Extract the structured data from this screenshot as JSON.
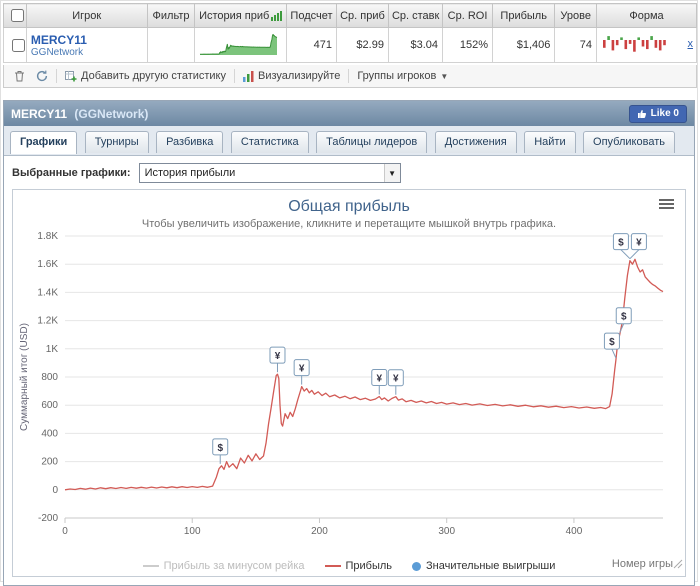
{
  "table": {
    "headers": [
      "Игрок",
      "Фильтр",
      "История приб",
      "Подсчет",
      "Ср. приб",
      "Ср. ставк",
      "Ср. ROI",
      "Прибыль",
      "Урове",
      "Форма"
    ],
    "row": {
      "player": "MERCY11",
      "network": "GGNetwork",
      "count": "471",
      "avg_profit": "$2.99",
      "avg_stake": "$3.04",
      "avg_roi": "152%",
      "profit": "$1,406",
      "level": "74",
      "remove_label": "x"
    },
    "form": [
      -6,
      3,
      -8,
      -4,
      2,
      -7,
      -3,
      -9,
      2,
      -5,
      -7,
      3,
      -6,
      -8,
      -4
    ]
  },
  "toolbar": {
    "add_stat": "Добавить другую статистику",
    "visualize": "Визуализируйте",
    "groups": "Группы игроков"
  },
  "panel": {
    "title_player": "MERCY11",
    "title_network": "(GGNetwork)",
    "like_label": "Like 0",
    "tabs": [
      "Графики",
      "Турниры",
      "Разбивка",
      "Статистика",
      "Таблицы лидеров",
      "Достижения",
      "Найти",
      "Опубликовать"
    ],
    "active_tab": "Графики",
    "selector_label": "Выбранные графики:",
    "selector_value": "История прибыли"
  },
  "chart_data": {
    "type": "line",
    "title": "Общая прибыль",
    "subtitle": "Чтобы увеличить изображение, кликните и перетащите мышкой внутрь графика.",
    "xlabel": "Номер игры",
    "ylabel": "Суммарный итог (USD)",
    "xlim": [
      0,
      470
    ],
    "ylim": [
      -200,
      1800
    ],
    "x_ticks": [
      0,
      100,
      200,
      300,
      400
    ],
    "y_ticks": [
      -200,
      0,
      200,
      400,
      600,
      800,
      1000,
      1200,
      1400,
      1600,
      1800
    ],
    "y_tick_labels": [
      "-200",
      "0",
      "200",
      "400",
      "600",
      "800",
      "1K",
      "1.2K",
      "1.4K",
      "1.6K",
      "1.8K"
    ],
    "grid": "horizontal",
    "legend_position": "bottom",
    "legend": [
      {
        "label": "Прибыль за минусом рейка",
        "color": "#cccccc",
        "type": "line",
        "disabled": true
      },
      {
        "label": "Прибыль",
        "color": "#d25b56",
        "type": "line",
        "disabled": false
      },
      {
        "label": "Значительные выигрыши",
        "color": "#5b9cd6",
        "type": "dot",
        "disabled": false
      }
    ],
    "series": [
      {
        "name": "Прибыль",
        "color": "#d25b56",
        "points": [
          [
            0,
            0
          ],
          [
            4,
            6
          ],
          [
            8,
            2
          ],
          [
            12,
            10
          ],
          [
            16,
            4
          ],
          [
            20,
            12
          ],
          [
            24,
            6
          ],
          [
            28,
            14
          ],
          [
            32,
            8
          ],
          [
            36,
            15
          ],
          [
            40,
            9
          ],
          [
            44,
            16
          ],
          [
            48,
            10
          ],
          [
            52,
            17
          ],
          [
            56,
            11
          ],
          [
            60,
            18
          ],
          [
            64,
            12
          ],
          [
            68,
            19
          ],
          [
            72,
            13
          ],
          [
            76,
            20
          ],
          [
            80,
            14
          ],
          [
            84,
            21
          ],
          [
            88,
            15
          ],
          [
            92,
            22
          ],
          [
            96,
            16
          ],
          [
            100,
            23
          ],
          [
            104,
            17
          ],
          [
            108,
            24
          ],
          [
            112,
            18
          ],
          [
            116,
            26
          ],
          [
            119,
            90
          ],
          [
            121,
            150
          ],
          [
            123,
            170
          ],
          [
            125,
            145
          ],
          [
            127,
            200
          ],
          [
            129,
            160
          ],
          [
            132,
            185
          ],
          [
            135,
            150
          ],
          [
            138,
            225
          ],
          [
            141,
            190
          ],
          [
            144,
            245
          ],
          [
            147,
            205
          ],
          [
            150,
            255
          ],
          [
            153,
            215
          ],
          [
            156,
            240
          ],
          [
            158,
            330
          ],
          [
            160,
            470
          ],
          [
            162,
            580
          ],
          [
            164,
            700
          ],
          [
            166,
            810
          ],
          [
            167,
            820
          ],
          [
            168,
            790
          ],
          [
            169,
            600
          ],
          [
            170,
            470
          ],
          [
            171,
            452
          ],
          [
            173,
            540
          ],
          [
            175,
            505
          ],
          [
            177,
            550
          ],
          [
            179,
            520
          ],
          [
            181,
            575
          ],
          [
            183,
            640
          ],
          [
            185,
            700
          ],
          [
            186,
            732
          ],
          [
            188,
            700
          ],
          [
            190,
            718
          ],
          [
            192,
            688
          ],
          [
            194,
            705
          ],
          [
            196,
            678
          ],
          [
            199,
            695
          ],
          [
            202,
            668
          ],
          [
            205,
            685
          ],
          [
            208,
            660
          ],
          [
            212,
            672
          ],
          [
            216,
            652
          ],
          [
            220,
            664
          ],
          [
            224,
            646
          ],
          [
            228,
            658
          ],
          [
            232,
            640
          ],
          [
            236,
            650
          ],
          [
            240,
            634
          ],
          [
            244,
            644
          ],
          [
            247,
            662
          ],
          [
            249,
            640
          ],
          [
            251,
            652
          ],
          [
            254,
            630
          ],
          [
            257,
            648
          ],
          [
            260,
            660
          ],
          [
            262,
            636
          ],
          [
            265,
            645
          ],
          [
            268,
            625
          ],
          [
            272,
            634
          ],
          [
            276,
            620
          ],
          [
            280,
            630
          ],
          [
            284,
            616
          ],
          [
            288,
            626
          ],
          [
            292,
            612
          ],
          [
            296,
            620
          ],
          [
            300,
            608
          ],
          [
            305,
            616
          ],
          [
            310,
            604
          ],
          [
            315,
            612
          ],
          [
            320,
            601
          ],
          [
            326,
            609
          ],
          [
            332,
            598
          ],
          [
            338,
            606
          ],
          [
            344,
            595
          ],
          [
            350,
            603
          ],
          [
            356,
            592
          ],
          [
            362,
            600
          ],
          [
            368,
            589
          ],
          [
            374,
            596
          ],
          [
            380,
            586
          ],
          [
            386,
            593
          ],
          [
            392,
            583
          ],
          [
            398,
            590
          ],
          [
            404,
            580
          ],
          [
            410,
            587
          ],
          [
            416,
            578
          ],
          [
            421,
            584
          ],
          [
            425,
            576
          ],
          [
            428,
            590
          ],
          [
            430,
            680
          ],
          [
            432,
            850
          ],
          [
            433,
            920
          ],
          [
            434,
            1010
          ],
          [
            435,
            1060
          ],
          [
            436,
            1100
          ],
          [
            438,
            1190
          ],
          [
            440,
            1360
          ],
          [
            442,
            1520
          ],
          [
            444,
            1625
          ],
          [
            446,
            1600
          ],
          [
            448,
            1635
          ],
          [
            450,
            1580
          ],
          [
            452,
            1545
          ],
          [
            454,
            1560
          ],
          [
            456,
            1510
          ],
          [
            458,
            1490
          ],
          [
            460,
            1470
          ],
          [
            462,
            1455
          ],
          [
            464,
            1445
          ],
          [
            466,
            1430
          ],
          [
            468,
            1415
          ],
          [
            470,
            1406
          ]
        ]
      }
    ],
    "markers": [
      {
        "x": 122,
        "y": 170,
        "symbol": "$",
        "dx": 0
      },
      {
        "x": 167,
        "y": 820,
        "symbol": "¥",
        "dx": 0
      },
      {
        "x": 186,
        "y": 732,
        "symbol": "¥",
        "dx": 0
      },
      {
        "x": 247,
        "y": 662,
        "symbol": "¥",
        "dx": 0
      },
      {
        "x": 260,
        "y": 660,
        "symbol": "¥",
        "dx": 0
      },
      {
        "x": 433,
        "y": 920,
        "symbol": "$",
        "dx": -4
      },
      {
        "x": 436,
        "y": 1100,
        "symbol": "$",
        "dx": 4
      },
      {
        "x": 444,
        "y": 1625,
        "symbol": "$",
        "dx": -9
      },
      {
        "x": 444,
        "y": 1625,
        "symbol": "¥",
        "dx": 9
      }
    ]
  }
}
